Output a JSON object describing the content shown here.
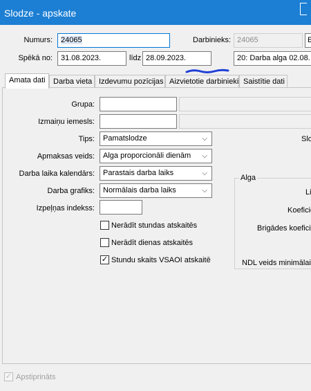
{
  "window": {
    "title": "Slodze - apskate"
  },
  "header": {
    "numurs_label": "Numurs:",
    "numurs_value": "24065",
    "darbinieks_label": "Darbinieks:",
    "darbinieks_value": "24065",
    "darbinieks_extra": "E",
    "speka_label": "Spēkā no:",
    "speka_value": "31.08.2023.",
    "lidz_label": "līdz",
    "lidz_value": "28.09.2023.",
    "alga_field": "20: Darba alga  02.08."
  },
  "tabs": [
    {
      "label": "Amata dati",
      "active": true
    },
    {
      "label": "Darba vieta"
    },
    {
      "label": "Izdevumu pozīcijas"
    },
    {
      "label": "Aizvietotie darbinieki"
    },
    {
      "label": "Saistītie dati"
    }
  ],
  "form": {
    "grupa_label": "Grupa:",
    "grupa_value": "",
    "izmainu_label": "Izmaiņu iemesls:",
    "izmainu_value": "",
    "tips_label": "Tips:",
    "tips_value": "Pamatslodze",
    "apmaksas_label": "Apmaksas veids:",
    "apmaksas_value": "Alga proporcionāli dienām",
    "kalendars_label": "Darba laika kalendārs:",
    "kalendars_value": "Parastais darba laiks",
    "grafiks_label": "Darba grafiks:",
    "grafiks_value": "Normālais darba laiks",
    "indekss_label": "Izpeļņas indekss:",
    "indekss_value": "",
    "right_cut_label": "Slo"
  },
  "checkboxes": [
    {
      "label": "Nerādīt stundas atskaitēs",
      "checked": false
    },
    {
      "label": "Nerādīt dienas atskaitēs",
      "checked": false
    },
    {
      "label": "Stundu skaits VSAOI atskaitē",
      "checked": true
    }
  ],
  "alga_group": {
    "caption": "Alga",
    "row1": "Lik",
    "row2": "Koeficie",
    "row3": "Brigādes koeficie",
    "row4": "NDL veids minimālai a"
  },
  "footer": {
    "apstiprinats_label": "Apstiprināts",
    "checked": true
  }
}
